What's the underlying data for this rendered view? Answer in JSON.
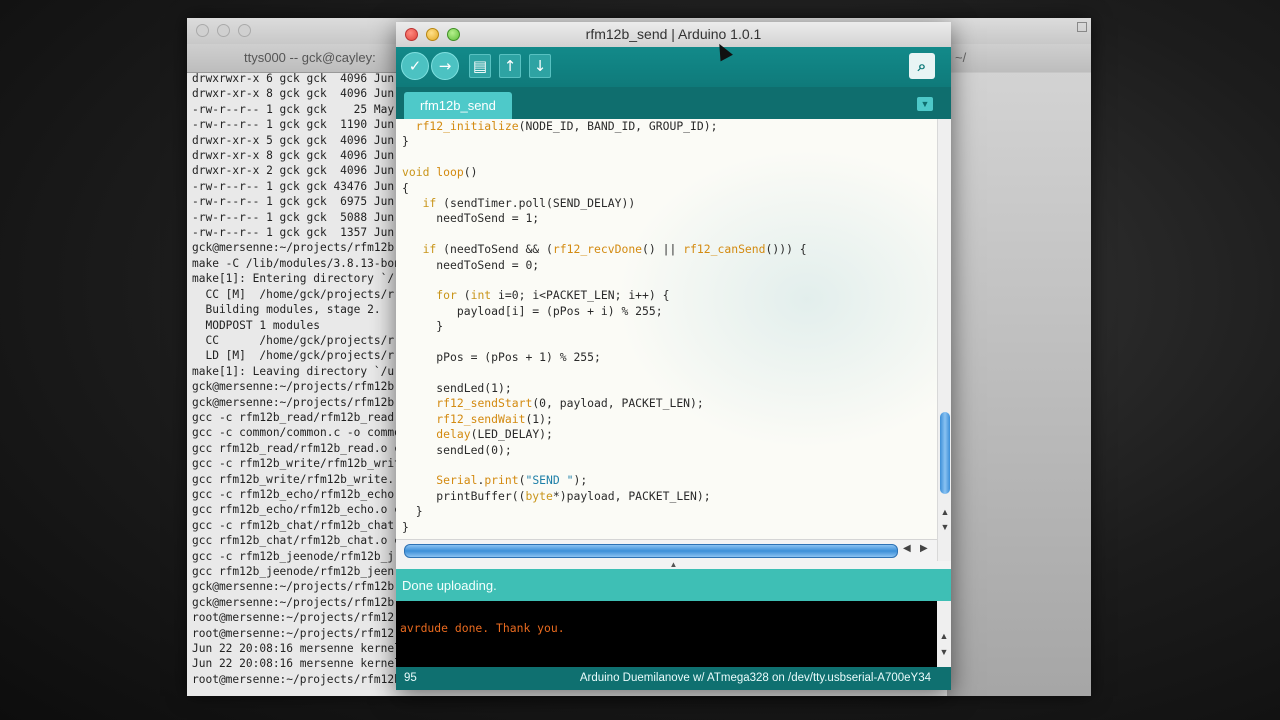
{
  "terminal": {
    "tab_title": "ttys000 -- gck@cayley:",
    "tab_title_2": "~/",
    "lines": [
      "drwxrwxr-x 6 gck gck  4096 Jun",
      "drwxr-xr-x 8 gck gck  4096 Jun",
      "-rw-r--r-- 1 gck gck    25 May",
      "-rw-r--r-- 1 gck gck  1190 Jun",
      "drwxr-xr-x 5 gck gck  4096 Jun",
      "drwxr-xr-x 8 gck gck  4096 Jun",
      "drwxr-xr-x 2 gck gck  4096 Jun",
      "-rw-r--r-- 1 gck gck 43476 Jun",
      "-rw-r--r-- 1 gck gck  6975 Jun",
      "-rw-r--r-- 1 gck gck  5088 Jun",
      "-rw-r--r-- 1 gck gck  1357 Jun",
      "gck@mersenne:~/projects/rfm12b",
      "make -C /lib/modules/3.8.13-bon",
      "make[1]: Entering directory `/",
      "  CC [M]  /home/gck/projects/r",
      "  Building modules, stage 2.",
      "  MODPOST 1 modules",
      "  CC      /home/gck/projects/r",
      "  LD [M]  /home/gck/projects/r",
      "make[1]: Leaving directory `/u",
      "gck@mersenne:~/projects/rfm12b",
      "gck@mersenne:~/projects/rfm12b",
      "gcc -c rfm12b_read/rfm12b_read.",
      "gcc -c common/common.c -o commo",
      "gcc rfm12b_read/rfm12b_read.o c",
      "gcc -c rfm12b_write/rfm12b_writ",
      "gcc rfm12b_write/rfm12b_write.",
      "gcc -c rfm12b_echo/rfm12b_echo.",
      "gcc rfm12b_echo/rfm12b_echo.o c",
      "gcc -c rfm12b_chat/rfm12b_chat.",
      "gcc rfm12b_chat/rfm12b_chat.o c",
      "gcc -c rfm12b_jeenode/rfm12b_j",
      "gcc rfm12b_jeenode/rfm12b_jeen",
      "gck@mersenne:~/projects/rfm12b",
      "gck@mersenne:~/projects/rfm12b",
      "root@mersenne:~/projects/rfm12",
      "root@mersenne:~/projects/rfm12",
      "Jun 22 20:08:16 mersenne kernel",
      "Jun 22 20:08:16 mersenne kernel",
      "root@mersenne:~/projects/rfm12b"
    ]
  },
  "ide": {
    "title": "rfm12b_send | Arduino 1.0.1",
    "toolbar": {
      "verify_icon": "✓",
      "upload_icon": "→",
      "new_icon": "▤",
      "open_icon": "↑",
      "save_icon": "↓",
      "monitor_icon": "⌕"
    },
    "tab_label": "rfm12b_send",
    "tab_menu_icon": "▼",
    "status": "Done uploading.",
    "console": "avrdude done.  Thank you.",
    "line_number": "95",
    "board_info": "Arduino Duemilanove w/ ATmega328 on /dev/tty.usbserial-A700eY34"
  },
  "code_lines": [
    [
      {
        "t": "  "
      },
      {
        "t": "rf12_initialize",
        "c": "fn"
      },
      {
        "t": "(NODE_ID, BAND_ID, GROUP_ID);"
      }
    ],
    [
      {
        "t": "}"
      }
    ],
    [
      {
        "t": ""
      }
    ],
    [
      {
        "t": "void",
        "c": "kw"
      },
      {
        "t": " "
      },
      {
        "t": "loop",
        "c": "fn"
      },
      {
        "t": "()"
      }
    ],
    [
      {
        "t": "{"
      }
    ],
    [
      {
        "t": "   "
      },
      {
        "t": "if",
        "c": "kw"
      },
      {
        "t": " (sendTimer.poll(SEND_DELAY))"
      }
    ],
    [
      {
        "t": "     needToSend = 1;"
      }
    ],
    [
      {
        "t": ""
      }
    ],
    [
      {
        "t": "   "
      },
      {
        "t": "if",
        "c": "kw"
      },
      {
        "t": " (needToSend && ("
      },
      {
        "t": "rf12_recvDone",
        "c": "fn"
      },
      {
        "t": "() || "
      },
      {
        "t": "rf12_canSend",
        "c": "fn"
      },
      {
        "t": "())) {"
      }
    ],
    [
      {
        "t": "     needToSend = 0;"
      }
    ],
    [
      {
        "t": ""
      }
    ],
    [
      {
        "t": "     "
      },
      {
        "t": "for",
        "c": "kw"
      },
      {
        "t": " ("
      },
      {
        "t": "int",
        "c": "kw"
      },
      {
        "t": " i=0; i<PACKET_LEN; i++) {"
      }
    ],
    [
      {
        "t": "        payload[i] = (pPos + i) % 255;"
      }
    ],
    [
      {
        "t": "     }"
      }
    ],
    [
      {
        "t": ""
      }
    ],
    [
      {
        "t": "     pPos = (pPos + 1) % 255;"
      }
    ],
    [
      {
        "t": ""
      }
    ],
    [
      {
        "t": "     sendLed(1);"
      }
    ],
    [
      {
        "t": "     "
      },
      {
        "t": "rf12_sendStart",
        "c": "fn"
      },
      {
        "t": "(0, payload, PACKET_LEN);"
      }
    ],
    [
      {
        "t": "     "
      },
      {
        "t": "rf12_sendWait",
        "c": "fn"
      },
      {
        "t": "(1);"
      }
    ],
    [
      {
        "t": "     "
      },
      {
        "t": "delay",
        "c": "fn"
      },
      {
        "t": "(LED_DELAY);"
      }
    ],
    [
      {
        "t": "     sendLed(0);"
      }
    ],
    [
      {
        "t": ""
      }
    ],
    [
      {
        "t": "     "
      },
      {
        "t": "Serial",
        "c": "fn"
      },
      {
        "t": "."
      },
      {
        "t": "print",
        "c": "fn"
      },
      {
        "t": "("
      },
      {
        "t": "\"SEND \"",
        "c": "str"
      },
      {
        "t": ");"
      }
    ],
    [
      {
        "t": "     printBuffer(("
      },
      {
        "t": "byte",
        "c": "kw"
      },
      {
        "t": "*)payload, PACKET_LEN);"
      }
    ],
    [
      {
        "t": "  }"
      }
    ],
    [
      {
        "t": "}"
      }
    ]
  ]
}
